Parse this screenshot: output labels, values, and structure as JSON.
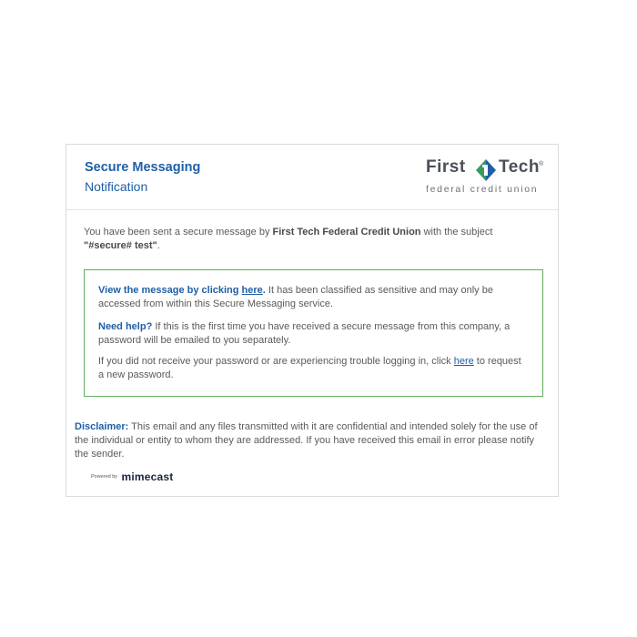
{
  "header": {
    "title": "Secure Messaging",
    "subtitle": "Notification"
  },
  "logo": {
    "word_first": "First",
    "word_tech": "Tech",
    "registered": "®",
    "tagline": "federal credit union",
    "brand_green": "#3a9a5b",
    "brand_blue": "#1f5fa6"
  },
  "intro": {
    "part1": "You have been sent a secure message by ",
    "sender": "First Tech Federal Credit Union",
    "part2": " with the subject ",
    "subject": "\"#secure# test\"",
    "part3": "."
  },
  "notice": {
    "view_label": "View the message by clicking ",
    "view_link": "here",
    "view_period": ".",
    "view_rest": " It has been classified as sensitive and may only be accessed from within this Secure Messaging service.",
    "help_label": "Need help?",
    "help_rest": " If this is the first time you have received a secure message from this company, a password will be emailed to you separately.",
    "trouble_part1": "If you did not receive your password or are experiencing trouble logging in, click ",
    "trouble_link": "here",
    "trouble_part2": " to request a new password."
  },
  "disclaimer": {
    "label": "Disclaimer:",
    "text": " This email and any files transmitted with it are confidential and intended solely for the use of the individual or entity to whom they are addressed. If you have received this email in error please notify the sender."
  },
  "footer": {
    "powered_by": "Powered by",
    "brand": "mimecast"
  },
  "colors": {
    "accent_blue": "#1f5fa6",
    "box_border_green": "#5fae5f",
    "body_text": "#5a5a5a"
  }
}
